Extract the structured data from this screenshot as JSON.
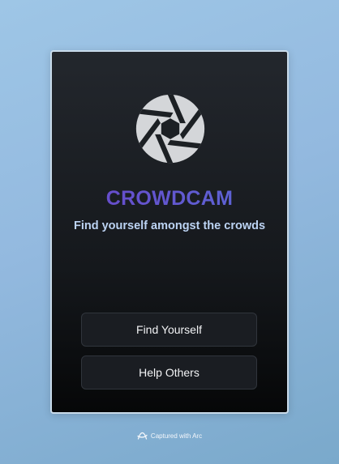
{
  "app": {
    "brand_name": "CROWDCAM",
    "tagline": "Find yourself amongst the crowds",
    "logo_icon": "camera-aperture-icon"
  },
  "actions": {
    "find_yourself_label": "Find Yourself",
    "help_others_label": "Help Others"
  },
  "footer": {
    "capture_text": "Captured with Arc",
    "icon": "arc-logo-icon"
  },
  "colors": {
    "background_start": "#9ec6e6",
    "background_end": "#7aa9cb",
    "panel_top": "#23272d",
    "panel_bottom": "#060708",
    "brand_gradient_start": "#6a45c8",
    "brand_gradient_end": "#5a6ad8",
    "tagline": "#bcd3f3",
    "button_bg": "#1a1d22",
    "button_text": "#f2f3f5"
  }
}
